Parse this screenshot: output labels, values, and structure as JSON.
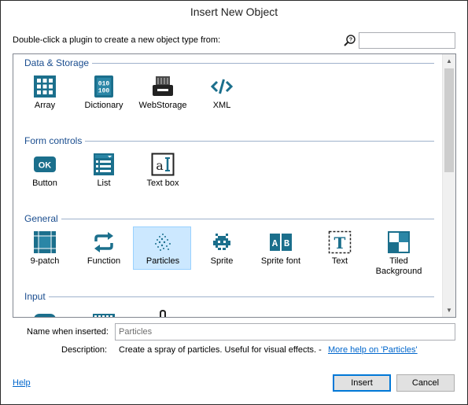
{
  "window": {
    "title": "Insert New Object"
  },
  "instructions": "Double-click a plugin to create a new object type from:",
  "search": {
    "value": "",
    "placeholder": ""
  },
  "categories": [
    {
      "label": "Data & Storage",
      "items": [
        {
          "label": "Array",
          "icon": "array-grid-icon"
        },
        {
          "label": "Dictionary",
          "icon": "dictionary-icon"
        },
        {
          "label": "WebStorage",
          "icon": "webstorage-icon"
        },
        {
          "label": "XML",
          "icon": "xml-code-icon"
        }
      ]
    },
    {
      "label": "Form controls",
      "items": [
        {
          "label": "Button",
          "icon": "ok-button-icon"
        },
        {
          "label": "List",
          "icon": "list-icon"
        },
        {
          "label": "Text box",
          "icon": "textbox-icon"
        }
      ]
    },
    {
      "label": "General",
      "items": [
        {
          "label": "9-patch",
          "icon": "ninepatch-icon"
        },
        {
          "label": "Function",
          "icon": "function-arrows-icon"
        },
        {
          "label": "Particles",
          "icon": "particles-icon",
          "selected": true
        },
        {
          "label": "Sprite",
          "icon": "sprite-invader-icon"
        },
        {
          "label": "Sprite font",
          "icon": "sprite-font-icon"
        },
        {
          "label": "Text",
          "icon": "text-icon"
        },
        {
          "label": "Tiled Background",
          "icon": "tiled-background-icon"
        }
      ]
    },
    {
      "label": "Input",
      "items": [
        {
          "label": "",
          "icon": "gamepad-icon"
        },
        {
          "label": "",
          "icon": "keyboard-icon"
        },
        {
          "label": "",
          "icon": "touch-icon"
        }
      ]
    }
  ],
  "name_field": {
    "label": "Name when inserted:",
    "value": "Particles"
  },
  "description": {
    "label": "Description:",
    "text": "Create a spray of particles.  Useful for visual effects. -",
    "link": "More help on 'Particles'"
  },
  "footer": {
    "help": "Help",
    "insert": "Insert",
    "cancel": "Cancel"
  },
  "colors": {
    "icon": "#1b6f8c",
    "category": "#1a4d8f",
    "selection": "#cce8ff",
    "link": "#0066cc"
  }
}
